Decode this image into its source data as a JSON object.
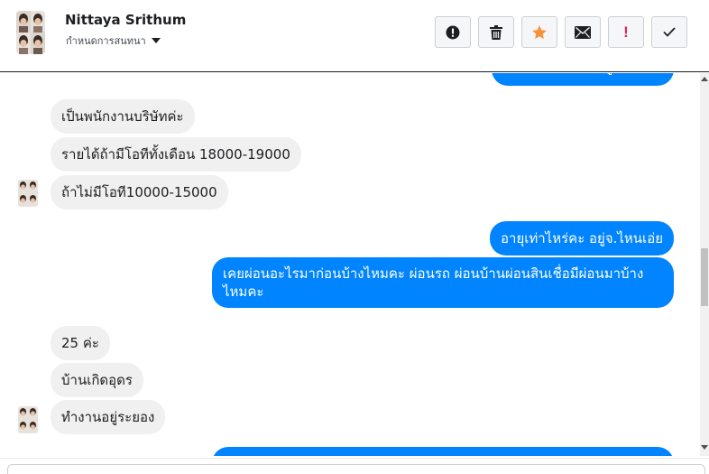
{
  "header": {
    "name": "Nittaya Srithum",
    "subtitle": "กำหนดการสนทนา"
  },
  "toolbar": {
    "buttons": [
      {
        "icon": "alert-circle-icon",
        "tooltip": "Mark as spam"
      },
      {
        "icon": "trash-icon",
        "tooltip": "Delete"
      },
      {
        "icon": "star-icon",
        "tooltip": "Star",
        "color": "#f7923b"
      },
      {
        "icon": "envelope-icon",
        "tooltip": "Mark as unread"
      },
      {
        "icon": "exclamation-icon",
        "label": "!",
        "color": "#e0245e"
      },
      {
        "icon": "checkmark-icon",
        "tooltip": "Mark as done"
      }
    ]
  },
  "messages": [
    {
      "from": "me",
      "text": "ค่ะ แล้วที่ทำงานอยู่ตอนนี้ทำอะไรคะ"
    },
    {
      "from": "contact",
      "text": "เป็นพนักงานบริษัทค่ะ"
    },
    {
      "from": "contact",
      "text": "รายได้ถ้ามีโอทีทั้งเดือน 18000-19000"
    },
    {
      "from": "contact",
      "text": "ถ้าไม่มีโอที10000-15000"
    },
    {
      "from": "me",
      "text": "อายุเท่าไหร่คะ อยู่จ.ไหนเอ่ย"
    },
    {
      "from": "me",
      "text_line1": "เคยผ่อนอะไรมาก่อนบ้างไหมคะ ผ่อนรถ ผ่อนบ้านผ่อนสินเชื่อมีผ่อนมาบ้าง",
      "text_line2": "ไหมคะ"
    },
    {
      "from": "contact",
      "text": "25 ค่ะ"
    },
    {
      "from": "contact",
      "text": "บ้านเกิดอุดร"
    },
    {
      "from": "contact",
      "text": "ทำงานอยู่ระยอง"
    }
  ],
  "colors": {
    "outgoing": "#0084ff",
    "incoming": "#f1f0f0",
    "star": "#f7923b",
    "exclamation": "#e0245e"
  }
}
